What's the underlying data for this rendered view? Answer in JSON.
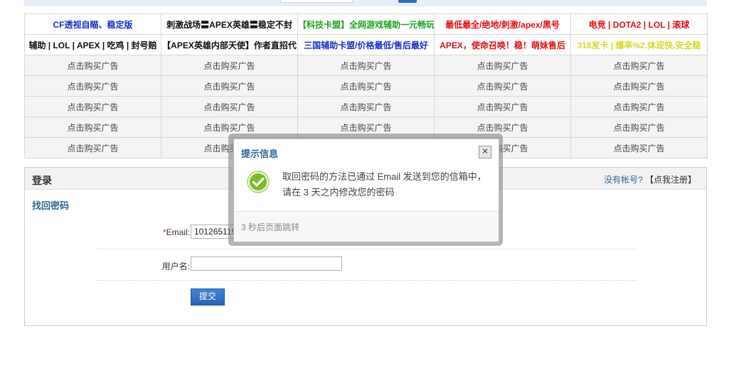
{
  "ads": {
    "text_rows": [
      [
        {
          "text": "CF透视自瞄、稳定版",
          "color": "#1a2fcc"
        },
        {
          "text": "刺激战场〓APEX英雄〓稳定不封",
          "color": "#111111"
        },
        {
          "text": "【科技卡盟】全网游戏辅助一元畅玩",
          "color": "#22a322"
        },
        {
          "text": "最低最全/绝地/刺激/apex/黑号",
          "color": "#dd1111"
        },
        {
          "text": "电竞 | DOTA2 | LOL | 滚球",
          "color": "#dd1111"
        }
      ],
      [
        {
          "text": "辅助 | LOL | APEX | 吃鸡 | 封号赔",
          "color": "#111111"
        },
        {
          "text": "【APEX英雄内部天使】作者直招代",
          "color": "#111111"
        },
        {
          "text": "三国辅助卡盟/价格最低/售后最好",
          "color": "#1a2fcc"
        },
        {
          "text": "APEX，使命召唤！稳！萌妹售后",
          "color": "#dd1111"
        },
        {
          "text": "318发卡 | 爆率%2.体现快.安全稳",
          "color": "#d8d82a"
        }
      ]
    ],
    "buy_label": "点击购买广告"
  },
  "panel": {
    "title": "登录",
    "no_account": "没有帐号?",
    "register_link": "【点我注册】",
    "find_password": "找回密码",
    "email_label_req": "*",
    "email_label": "Email:",
    "email_value": "101265119",
    "username_label": "用户名:",
    "username_value": "",
    "submit_label": "提交"
  },
  "modal": {
    "title": "提示信息",
    "close_symbol": "✕",
    "message": "取回密码的方法已通过 Email 发送到您的信箱中，请在 3 天之内修改您的密码",
    "footer": "3 秒后页面跳转",
    "icon": "check-circle-icon",
    "icon_color": "#7dbb2a"
  }
}
